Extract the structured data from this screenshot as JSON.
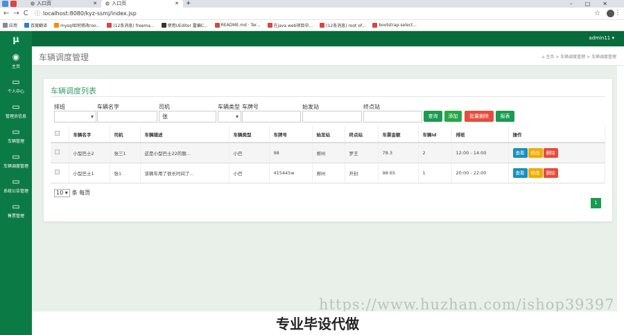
{
  "browser": {
    "tabs": [
      {
        "label": "入口页"
      },
      {
        "label": "入口页"
      }
    ],
    "url": "localhost:8080/kyz-ssmj/index.jsp",
    "bookmarks": [
      "应用",
      "百度翻译",
      "mysql如何修改roo...",
      "(12条消息) freema...",
      "使用UEditor 富编C...",
      "README.md · Ter...",
      "在java web项目中...",
      "(12条消息) root of...",
      "bootstrap-select..."
    ]
  },
  "sidebar": {
    "logo": "μ",
    "items": [
      {
        "icon": "dashboard-icon",
        "label": "主页"
      },
      {
        "icon": "monitor-icon",
        "label": "个人中心"
      },
      {
        "icon": "monitor-icon",
        "label": "管理员信息"
      },
      {
        "icon": "monitor-icon",
        "label": "车辆管理"
      },
      {
        "icon": "monitor-icon",
        "label": "车辆调度管理"
      },
      {
        "icon": "monitor-icon",
        "label": "系统公告管理"
      },
      {
        "icon": "monitor-icon",
        "label": "售票管理"
      }
    ]
  },
  "header": {
    "user": "admin11 ▾"
  },
  "page": {
    "title": "车辆调度管理",
    "crumb": "⌂ 主页  >  车辆调度管理  >  车辆调度管理"
  },
  "card": {
    "title": "车辆调度列表"
  },
  "filters": {
    "labels": [
      "排班",
      "车辆名字",
      "司机",
      "车辆类型",
      "车牌号",
      "始发站",
      "终点站"
    ],
    "driver_value": "张"
  },
  "buttons": {
    "search": "查询",
    "add": "添加",
    "batch_delete": "批量删除",
    "report": "报表"
  },
  "table": {
    "columns": [
      "车辆名字",
      "司机",
      "车辆描述",
      "车辆类型",
      "车牌号",
      "始发站",
      "终点站",
      "车票金额",
      "车辆id",
      "排班",
      "操作"
    ],
    "rows": [
      [
        "小型巴士2",
        "张三1",
        "这是小型巴士22的题...",
        "小巴",
        "98",
        "郑州",
        "罗王",
        "78.3",
        "2",
        "12:00 - 14:00"
      ],
      [
        "小型巴士1",
        "张1",
        "该辆车用了很长时间了...",
        "小巴",
        "415445w",
        "郑州",
        "开封",
        "98.65",
        "1",
        "20:00 - 22:00"
      ]
    ],
    "actions": {
      "view": "查看",
      "edit": "修改",
      "delete": "删除"
    }
  },
  "pagination": {
    "page_size": "10",
    "per_page_label": "条 每页",
    "current": "1"
  },
  "watermark": {
    "url": "https://www.huzhan.com/ishop39397",
    "slogan": "专业毕设代做"
  },
  "colors": {
    "sidebar": "#0c7a44",
    "header": "#086b3c",
    "search": "#1a9a52",
    "add": "#28a745",
    "batch": "#e74c3c",
    "report": "#1a9a52",
    "view": "#1a8fbf",
    "edit": "#f0ad00",
    "delete": "#e74c3c"
  }
}
